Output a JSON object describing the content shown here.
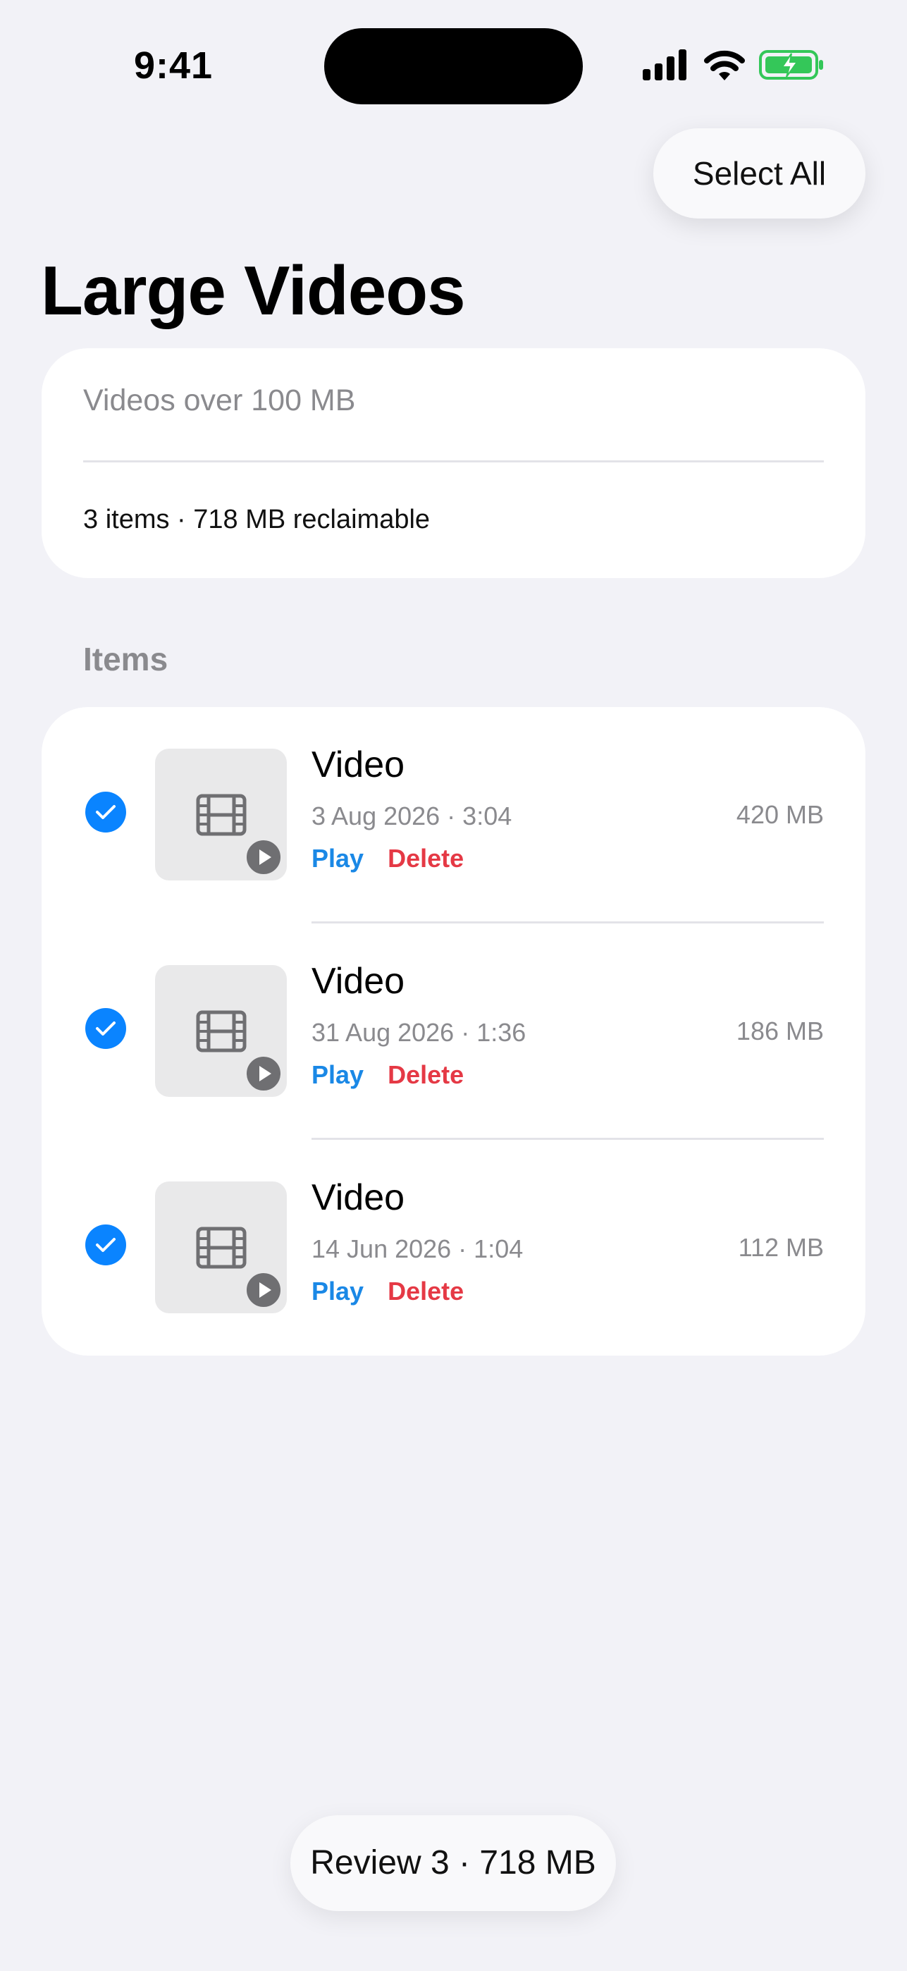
{
  "status_bar": {
    "time": "9:41"
  },
  "nav": {
    "select_all_label": "Select All"
  },
  "page": {
    "title": "Large Videos"
  },
  "summary": {
    "filter_label": "Videos over 100 MB",
    "stats": "3 items · 718 MB reclaimable"
  },
  "section": {
    "header": "Items"
  },
  "items": [
    {
      "title": "Video",
      "meta": "3 Aug 2026 · 3:04",
      "size": "420 MB",
      "play_label": "Play",
      "delete_label": "Delete",
      "selected": true
    },
    {
      "title": "Video",
      "meta": "31 Aug 2026 · 1:36",
      "size": "186 MB",
      "play_label": "Play",
      "delete_label": "Delete",
      "selected": true
    },
    {
      "title": "Video",
      "meta": "14 Jun 2026 · 1:04",
      "size": "112 MB",
      "play_label": "Play",
      "delete_label": "Delete",
      "selected": true
    }
  ],
  "footer": {
    "review_label": "Review 3 · 718 MB"
  },
  "colors": {
    "accent": "#0a84ff",
    "link_blue": "#1a88e6",
    "delete_red": "#e53945",
    "background": "#f2f2f7",
    "battery_green": "#34c759"
  },
  "icons": [
    "cellular-signal-icon",
    "wifi-icon",
    "battery-charging-icon",
    "checkmark-icon",
    "film-icon",
    "play-icon"
  ]
}
